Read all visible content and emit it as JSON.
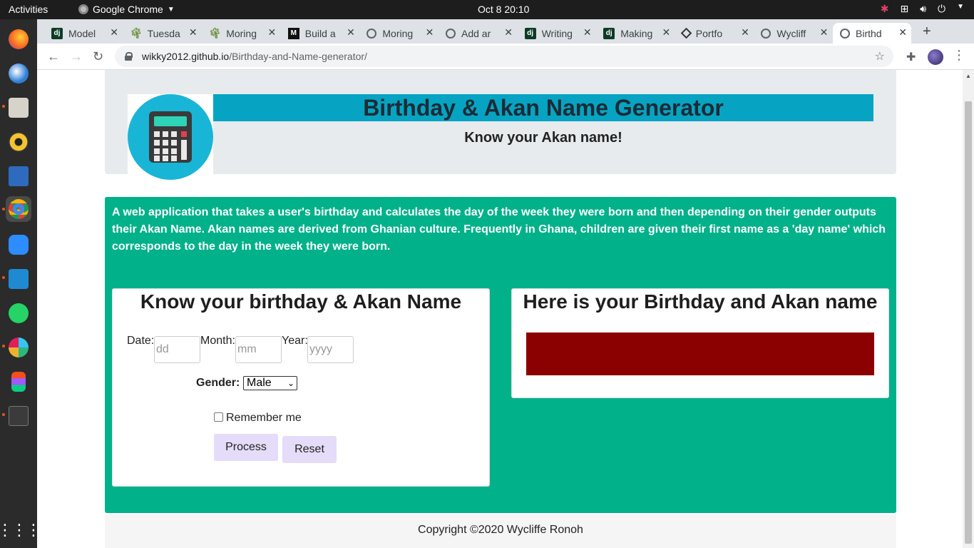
{
  "system": {
    "activities": "Activities",
    "app_name": "Google Chrome",
    "clock": "Oct 8  20:10"
  },
  "tabs": [
    {
      "title": "Model",
      "icon": "django-icon"
    },
    {
      "title": "Tuesda",
      "icon": "leaf-icon"
    },
    {
      "title": "Moring",
      "icon": "leaf-icon"
    },
    {
      "title": "Build a",
      "icon": "medium-icon"
    },
    {
      "title": "Moring",
      "icon": "globe-icon"
    },
    {
      "title": "Add ar",
      "icon": "globe-icon"
    },
    {
      "title": "Writing",
      "icon": "django-icon"
    },
    {
      "title": "Making",
      "icon": "django-icon"
    },
    {
      "title": "Portfo",
      "icon": "codepen-icon"
    },
    {
      "title": "Wycliff",
      "icon": "globe-icon"
    },
    {
      "title": "Birthd",
      "icon": "globe-icon",
      "active": true
    }
  ],
  "address": {
    "host": "wikky2012.github.io",
    "path": "/Birthday-and-Name-generator/"
  },
  "page": {
    "title": "Birthday & Akan Name Generator",
    "subtitle": "Know your Akan name!",
    "description": "A web application that takes a user's birthday and calculates the day of the week they were born and then depending on their gender outputs their Akan Name. Akan names are derived from Ghanian culture. Frequently in Ghana, children are given their first name as a 'day name' which corresponds to the day in the week they were born.",
    "form": {
      "heading": "Know your birthday & Akan Name",
      "date_label": "Date:",
      "date_placeholder": "dd",
      "month_label": "Month:",
      "month_placeholder": "mm",
      "year_label": "Year:",
      "year_placeholder": "yyyy",
      "gender_label": "Gender:",
      "gender_value": "Male",
      "remember_label": "Remember me",
      "process_button": "Process",
      "reset_button": "Reset"
    },
    "result": {
      "heading": "Here is your Birthday and Akan name"
    },
    "footer": "Copyright ©2020 Wycliffe Ronoh"
  },
  "colors": {
    "title_bar": "#06a4c2",
    "main_green": "#00b18a",
    "result_box": "#8b0000",
    "button": "#e4dcf8"
  }
}
